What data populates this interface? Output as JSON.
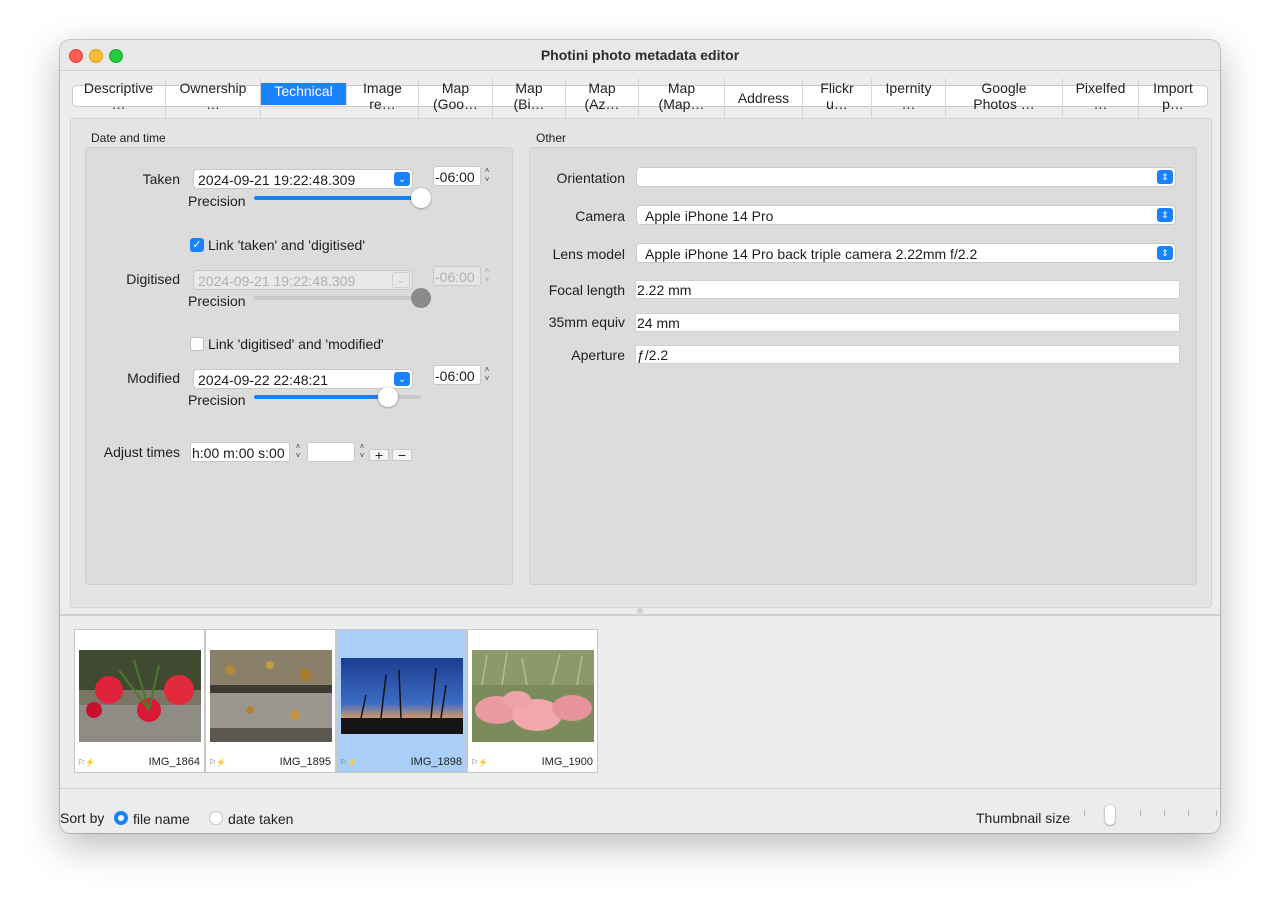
{
  "window": {
    "title": "Photini photo metadata editor"
  },
  "tabs": [
    {
      "label": "Descriptive\n…",
      "active": false
    },
    {
      "label": "Ownership\n…",
      "active": false
    },
    {
      "label": "Technical\n…",
      "active": true
    },
    {
      "label": "Image\nre…",
      "active": false
    },
    {
      "label": "Map\n(Goo…",
      "active": false
    },
    {
      "label": "Map\n(Bi…",
      "active": false
    },
    {
      "label": "Map\n(Az…",
      "active": false
    },
    {
      "label": "Map\n(Map…",
      "active": false
    },
    {
      "label": "Address",
      "active": false
    },
    {
      "label": "Flickr\nu…",
      "active": false
    },
    {
      "label": "Ipernity\n…",
      "active": false
    },
    {
      "label": "Google\nPhotos …",
      "active": false
    },
    {
      "label": "Pixelfed\n…",
      "active": false
    },
    {
      "label": "Import\np…",
      "active": false
    }
  ],
  "datetime": {
    "group_title": "Date and time",
    "taken": {
      "label": "Taken",
      "value": "2024-09-21 19:22:48.309",
      "tz": "-06:00",
      "precision_label": "Precision",
      "precision": 1.0
    },
    "link_taken_digitised": {
      "label": "Link 'taken' and 'digitised'",
      "checked": true
    },
    "digitised": {
      "label": "Digitised",
      "value": "2024-09-21 19:22:48.309",
      "tz": "-06:00",
      "precision_label": "Precision",
      "precision": 1.0
    },
    "link_digitised_modified": {
      "label": "Link 'digitised' and 'modified'",
      "checked": false
    },
    "modified": {
      "label": "Modified",
      "value": "2024-09-22 22:48:21",
      "tz": "-06:00",
      "precision_label": "Precision",
      "precision": 0.8
    },
    "adjust": {
      "label": "Adjust times",
      "value": "h:00 m:00 s:00",
      "extra_value": "",
      "plus": "+",
      "minus": "−"
    }
  },
  "other": {
    "group_title": "Other",
    "orientation": {
      "label": "Orientation",
      "value": ""
    },
    "camera": {
      "label": "Camera",
      "value": "Apple iPhone 14 Pro"
    },
    "lens": {
      "label": "Lens model",
      "value": "Apple iPhone 14 Pro back triple camera 2.22mm f/2.2"
    },
    "focal": {
      "label": "Focal length",
      "value": "2.22 mm"
    },
    "equiv": {
      "label": "35mm equiv",
      "value": "24 mm"
    },
    "aperture": {
      "label": "Aperture",
      "value": "ƒ/2.2"
    }
  },
  "thumbnails": [
    {
      "name": "IMG_1864",
      "selected": false
    },
    {
      "name": "IMG_1895",
      "selected": false
    },
    {
      "name": "IMG_1898",
      "selected": true
    },
    {
      "name": "IMG_1900",
      "selected": false
    }
  ],
  "thumb_flags": "⚐⚡",
  "footer": {
    "sort_by_label": "Sort by",
    "sort_file_name": "file name",
    "sort_date_taken": "date taken",
    "sort_selected": "file name",
    "thumb_size_label": "Thumbnail size",
    "thumb_size_level": 0.2
  },
  "colors": {
    "accent": "#1a82fb",
    "selected_thumb": "#a9cff8"
  }
}
